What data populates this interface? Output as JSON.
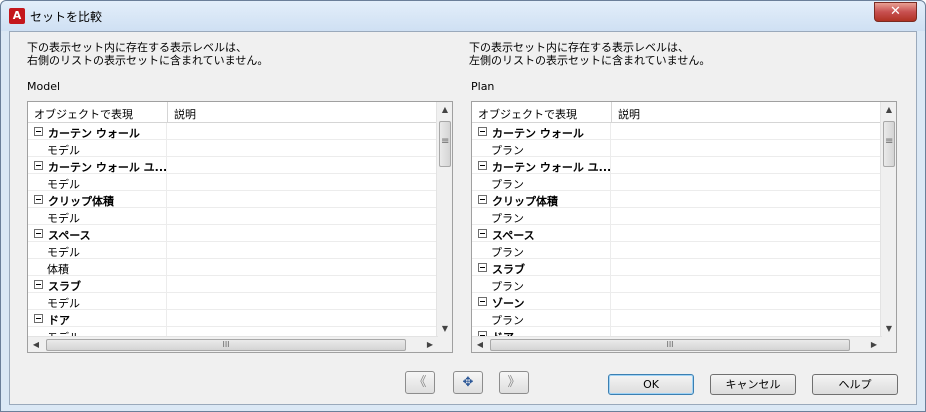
{
  "window": {
    "title": "セットを比較",
    "app_icon_glyph": "A",
    "close_glyph": "✕"
  },
  "left_panel": {
    "description_line1": "下の表示セット内に存在する表示レベルは、",
    "description_line2": "右側のリストの表示セットに含まれていません。",
    "set_name": "Model",
    "columns": [
      "オブジェクトで表現",
      "説明"
    ],
    "rows": [
      {
        "type": "group",
        "label": "カーテン ウォール"
      },
      {
        "type": "child",
        "label": "モデル"
      },
      {
        "type": "group",
        "label": "カーテン ウォール ユ..."
      },
      {
        "type": "child",
        "label": "モデル"
      },
      {
        "type": "group",
        "label": "クリップ体積"
      },
      {
        "type": "child",
        "label": "モデル"
      },
      {
        "type": "group",
        "label": "スペース"
      },
      {
        "type": "child",
        "label": "モデル"
      },
      {
        "type": "child",
        "label": "体積"
      },
      {
        "type": "group",
        "label": "スラブ"
      },
      {
        "type": "child",
        "label": "モデル"
      },
      {
        "type": "group",
        "label": "ドア"
      },
      {
        "type": "child",
        "label": "モデル"
      }
    ]
  },
  "right_panel": {
    "description_line1": "下の表示セット内に存在する表示レベルは、",
    "description_line2": "左側のリストの表示セットに含まれていません。",
    "set_name": "Plan",
    "columns": [
      "オブジェクトで表現",
      "説明"
    ],
    "rows": [
      {
        "type": "group",
        "label": "カーテン ウォール"
      },
      {
        "type": "child",
        "label": "プラン"
      },
      {
        "type": "group",
        "label": "カーテン ウォール ユ..."
      },
      {
        "type": "child",
        "label": "プラン"
      },
      {
        "type": "group",
        "label": "クリップ体積"
      },
      {
        "type": "child",
        "label": "プラン"
      },
      {
        "type": "group",
        "label": "スペース"
      },
      {
        "type": "child",
        "label": "プラン"
      },
      {
        "type": "group",
        "label": "スラブ"
      },
      {
        "type": "child",
        "label": "プラン"
      },
      {
        "type": "group",
        "label": "ゾーン"
      },
      {
        "type": "child",
        "label": "プラン"
      },
      {
        "type": "group",
        "label": "ドア"
      }
    ]
  },
  "transfer": {
    "move_left_glyph": "《",
    "add_glyph": "✥",
    "move_right_glyph": "》"
  },
  "buttons": {
    "ok": "OK",
    "cancel": "キャンセル",
    "help": "ヘルプ"
  },
  "scroll": {
    "up": "▲",
    "down": "▼",
    "left": "◀",
    "right": "▶",
    "grip": "III"
  }
}
